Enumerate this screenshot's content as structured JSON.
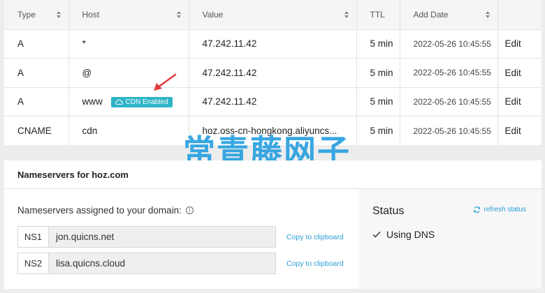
{
  "table": {
    "headers": [
      "Type",
      "Host",
      "Value",
      "TTL",
      "Add Date"
    ],
    "rows": [
      {
        "type": "A",
        "host": "*",
        "value": "47.242.11.42",
        "ttl": "5 min",
        "date": "2022-05-26 10:45:55",
        "edit": "Edit"
      },
      {
        "type": "A",
        "host": "@",
        "value": "47.242.11.42",
        "ttl": "5 min",
        "date": "2022-05-26 10:45:55",
        "edit": "Edit"
      },
      {
        "type": "A",
        "host": "www",
        "value": "47.242.11.42",
        "ttl": "5 min",
        "date": "2022-05-26 10:45:55",
        "edit": "Edit",
        "badge": "CDN Enabled"
      },
      {
        "type": "CNAME",
        "host": "cdn",
        "value": "hoz.oss-cn-hongkong.aliyuncs...",
        "ttl": "5 min",
        "date": "2022-05-26 10:45:55",
        "edit": "Edit"
      }
    ]
  },
  "watermark": "常青藤网子",
  "nameservers": {
    "title": "Nameservers for hoz.com",
    "assigned_label": "Nameservers assigned to your domain:",
    "info_glyph": "i",
    "items": [
      {
        "label": "NS1",
        "value": "jon.quicns.net",
        "copy": "Copy to clipboard"
      },
      {
        "label": "NS2",
        "value": "lisa.quicns.cloud",
        "copy": "Copy to clipboard"
      }
    ]
  },
  "status": {
    "title": "Status",
    "refresh": "refresh status",
    "value": "Using DNS"
  },
  "colors": {
    "accent": "#2a9fd6",
    "badge": "#2eb4c7",
    "arrow": "#e03a3a",
    "watermark": "#28a0e0"
  },
  "icons": {
    "sort": "sort-icon",
    "cloud": "cloud-icon",
    "info": "info-icon",
    "refresh": "refresh-icon",
    "check": "check-icon"
  }
}
